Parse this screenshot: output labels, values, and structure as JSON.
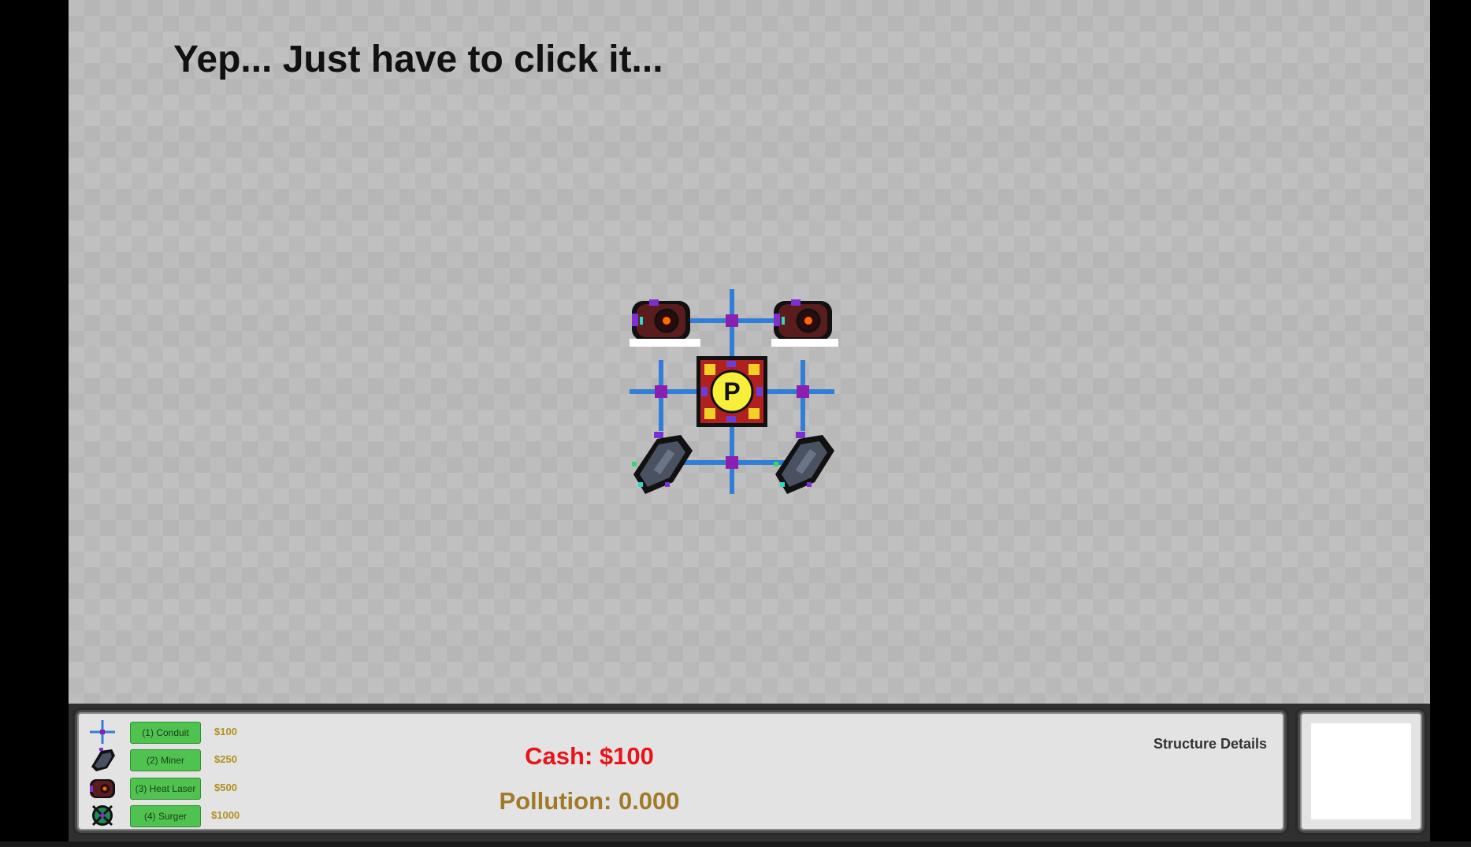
{
  "tutorial_text": "Yep... Just have to click it...",
  "hud": {
    "build_options": [
      {
        "key_label": "(1) Conduit",
        "price": "$100",
        "icon": "conduit-icon"
      },
      {
        "key_label": "(2) Miner",
        "price": "$250",
        "icon": "miner-icon"
      },
      {
        "key_label": "(3) Heat Laser",
        "price": "$500",
        "icon": "heat-laser-icon"
      },
      {
        "key_label": "(4) Surger",
        "price": "$1000",
        "icon": "surger-icon"
      }
    ],
    "cash_text": "Cash: $100",
    "pollution_text": "Pollution: 0.000",
    "structure_details_label": "Structure Details"
  },
  "colors": {
    "cash": "#e8141a",
    "pollution": "#a07a28",
    "build_button": "#4fc24f",
    "price": "#b09020",
    "conduit": "#2f7fd8",
    "junction": "#8a1fb0"
  }
}
